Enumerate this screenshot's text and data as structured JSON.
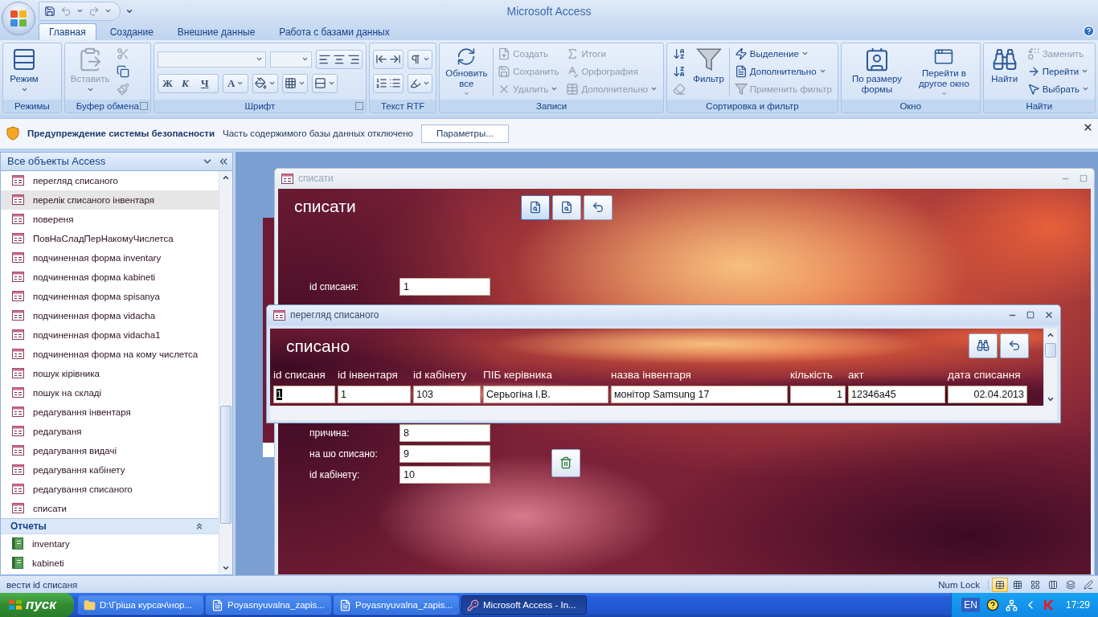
{
  "window": {
    "title": "Microsoft Access"
  },
  "ribbon_tabs": [
    {
      "label": "Главная",
      "selected": true
    },
    {
      "label": "Создание",
      "selected": false
    },
    {
      "label": "Внешние данные",
      "selected": false
    },
    {
      "label": "Работа с базами данных",
      "selected": false
    }
  ],
  "ribbon_groups": [
    {
      "kind": "commands",
      "label": "Режимы",
      "launcher": false,
      "items": [
        {
          "kind": "large",
          "label": "Режим",
          "dropdown": true,
          "disabled": false
        }
      ]
    },
    {
      "kind": "commands",
      "label": "Буфер обмена",
      "launcher": true,
      "items": [
        {
          "kind": "large",
          "label": "Вставить",
          "dropdown": true,
          "disabled": true
        },
        {
          "kind": "icon",
          "dropdown": false,
          "disabled": true
        },
        {
          "kind": "icon",
          "dropdown": false,
          "disabled": false
        },
        {
          "kind": "icon",
          "dropdown": false,
          "disabled": true
        }
      ]
    },
    {
      "kind": "font",
      "label": "Шрифт",
      "launcher": true,
      "style_buttons": [
        "Ж",
        "К",
        "Ч"
      ],
      "color_button": "А"
    },
    {
      "kind": "rtf",
      "label": "Текст RTF",
      "launcher": false
    },
    {
      "kind": "commands",
      "label": "Записи",
      "launcher": false,
      "items": [
        {
          "kind": "large",
          "label": "Обновить все",
          "dropdown": true,
          "disabled": false
        },
        {
          "kind": "small",
          "label": "Создать",
          "dropdown": false,
          "disabled": true
        },
        {
          "kind": "small",
          "label": "Сохранить",
          "dropdown": false,
          "disabled": true
        },
        {
          "kind": "small",
          "label": "Удалить",
          "dropdown": true,
          "disabled": true
        },
        {
          "kind": "small",
          "label": "Итоги",
          "dropdown": false,
          "disabled": true
        },
        {
          "kind": "small",
          "label": "Орфография",
          "dropdown": false,
          "disabled": true
        },
        {
          "kind": "small",
          "label": "Дополнительно",
          "dropdown": true,
          "disabled": true
        }
      ]
    },
    {
      "kind": "commands",
      "label": "Сортировка и фильтр",
      "launcher": false,
      "items": [
        {
          "kind": "icon",
          "dropdown": false,
          "disabled": false
        },
        {
          "kind": "icon",
          "dropdown": false,
          "disabled": false
        },
        {
          "kind": "icon",
          "dropdown": false,
          "disabled": true
        },
        {
          "kind": "large",
          "label": "Фильтр",
          "dropdown": false,
          "disabled": false
        },
        {
          "kind": "small",
          "label": "Выделение",
          "dropdown": true,
          "disabled": false
        },
        {
          "kind": "small",
          "label": "Дополнительно",
          "dropdown": true,
          "disabled": false
        },
        {
          "kind": "small",
          "label": "Применить фильтр",
          "dropdown": false,
          "disabled": true
        }
      ]
    },
    {
      "kind": "commands",
      "label": "Окно",
      "launcher": false,
      "items": [
        {
          "kind": "large",
          "label": "По размеру формы",
          "dropdown": false,
          "disabled": false
        },
        {
          "kind": "large",
          "label": "Перейти в другое окно",
          "dropdown": true,
          "disabled": false
        }
      ]
    },
    {
      "kind": "commands",
      "label": "Найти",
      "launcher": false,
      "items": [
        {
          "kind": "large",
          "label": "Найти",
          "dropdown": false,
          "disabled": false
        },
        {
          "kind": "small",
          "label": "Заменить",
          "dropdown": false,
          "disabled": true
        },
        {
          "kind": "small",
          "label": "Перейти",
          "dropdown": true,
          "disabled": false
        },
        {
          "kind": "small",
          "label": "Выбрать",
          "dropdown": true,
          "disabled": false
        }
      ]
    }
  ],
  "security_bar": {
    "title": "Предупреждение системы безопасности",
    "message": "Часть содержимого базы данных отключено",
    "button": "Параметры..."
  },
  "navigation": {
    "title": "Все объекты Access",
    "sections": [
      {
        "kind": "forms",
        "items": [
          {
            "label": "перегляд списаного",
            "selected": false
          },
          {
            "label": "перелік списаного інвентаря",
            "selected": true
          },
          {
            "label": "повереня",
            "selected": false
          },
          {
            "label": "ПовНаСладПерНакомуЧислетса",
            "selected": false
          },
          {
            "label": "подчиненная форма inventary",
            "selected": false
          },
          {
            "label": "подчиненная форма kabineti",
            "selected": false
          },
          {
            "label": "подчиненная форма spisanya",
            "selected": false
          },
          {
            "label": "подчиненная форма vidacha",
            "selected": false
          },
          {
            "label": "подчиненная форма vidacha1",
            "selected": false
          },
          {
            "label": "подчиненная форма на кому числетса",
            "selected": false
          },
          {
            "label": "пошук кірівника",
            "selected": false
          },
          {
            "label": "пошук на складі",
            "selected": false
          },
          {
            "label": "редагування інвентаря",
            "selected": false
          },
          {
            "label": "редагуваня",
            "selected": false
          },
          {
            "label": "редагування видачі",
            "selected": false
          },
          {
            "label": "редагування кабінету",
            "selected": false
          },
          {
            "label": "редагування списаного",
            "selected": false
          },
          {
            "label": "списати",
            "selected": false
          }
        ]
      },
      {
        "kind": "reports",
        "title": "Отчеты",
        "items": [
          {
            "label": "inventary",
            "selected": false
          },
          {
            "label": "kabineti",
            "selected": false
          }
        ]
      }
    ]
  },
  "form_window": {
    "title": "списати",
    "active": false,
    "heading": "списати",
    "toolbar_buttons": [
      {
        "selected": true
      },
      {
        "selected": false
      },
      {
        "selected": false
      }
    ],
    "fields_top": [
      {
        "label": "id списаня:",
        "value": "1"
      }
    ],
    "fields_bottom": [
      {
        "label": "причина:",
        "value": "8"
      },
      {
        "label": "на шо списано:",
        "value": "9"
      },
      {
        "label": "id кабінету:",
        "value": "10"
      }
    ]
  },
  "subform_window": {
    "title": "перегляд списаного",
    "active": true,
    "heading": "списано",
    "columns": [
      "id списаня",
      "id інвентаря",
      "id кабінету",
      "ПІБ керівника",
      "назва інвентаря",
      "кількість",
      "акт",
      "дата списання"
    ],
    "rows": [
      {
        "cells": [
          {
            "text": "1",
            "focused": true
          },
          {
            "text": "1",
            "focused": false
          },
          {
            "text": "103",
            "focused": false
          },
          {
            "text": "Серьогіна І.В.",
            "focused": false
          },
          {
            "text": "монітор Samsung 17",
            "focused": false
          },
          {
            "text": "1",
            "focused": false
          },
          {
            "text": "12346а45",
            "focused": false
          },
          {
            "text": "02.04.2013",
            "focused": false
          }
        ]
      }
    ]
  },
  "status_bar": {
    "text": "вести id списаня",
    "indicator": "Num Lock",
    "views": [
      {
        "selected": true
      },
      {
        "selected": false
      },
      {
        "selected": false
      },
      {
        "selected": false
      },
      {
        "selected": false
      },
      {
        "selected": false
      }
    ]
  },
  "taskbar": {
    "start": "пуск",
    "tasks": [
      {
        "kind": "folder",
        "label": "D:\\Гріша курсач\\нор...",
        "selected": false
      },
      {
        "kind": "word",
        "label": "Poyasnyuvalna_zapis...",
        "selected": false
      },
      {
        "kind": "word",
        "label": "Poyasnyuvalna_zapis...",
        "selected": false
      },
      {
        "kind": "access",
        "label": "Microsoft Access - In...",
        "selected": true
      }
    ],
    "language": "EN",
    "clock": "17:29"
  }
}
